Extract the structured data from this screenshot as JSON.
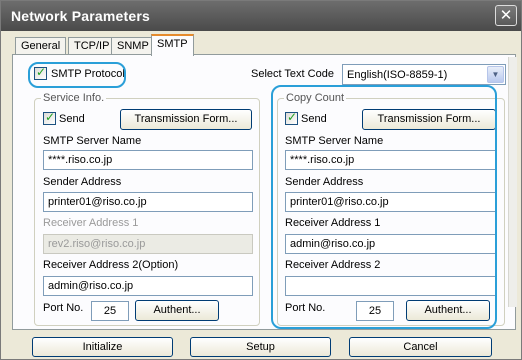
{
  "window": {
    "title": "Network Parameters",
    "close_glyph": "✕"
  },
  "tabs": [
    {
      "label": "General",
      "active": false
    },
    {
      "label": "TCP/IP",
      "active": false
    },
    {
      "label": "SNMP",
      "active": false
    },
    {
      "label": "SMTP",
      "active": true
    }
  ],
  "smtp_protocol": {
    "label": "SMTP Protocol",
    "checked": true
  },
  "text_code": {
    "label": "Select Text Code",
    "value": "English(ISO-8859-1)"
  },
  "service_info": {
    "title": "Service Info.",
    "send_label": "Send",
    "send_checked": true,
    "transmission_button": "Transmission Form...",
    "server_label": "SMTP Server Name",
    "server_value": "****.riso.co.jp",
    "sender_label": "Sender Address",
    "sender_value": "printer01@riso.co.jp",
    "receiver1_label": "Receiver Address 1",
    "receiver1_value": "rev2.riso@riso.co.jp",
    "receiver2_label": "Receiver Address 2(Option)",
    "receiver2_value": "admin@riso.co.jp",
    "port_label": "Port No.",
    "port_value": "25",
    "authent_button": "Authent..."
  },
  "copy_count": {
    "title": "Copy Count",
    "send_label": "Send",
    "send_checked": true,
    "transmission_button": "Transmission Form...",
    "server_label": "SMTP Server Name",
    "server_value": "****.riso.co.jp",
    "sender_label": "Sender Address",
    "sender_value": "printer01@riso.co.jp",
    "receiver1_label": "Receiver Address 1",
    "receiver1_value": "admin@riso.co.jp",
    "receiver2_label": "Receiver Address 2",
    "receiver2_value": "",
    "port_label": "Port No.",
    "port_value": "25",
    "authent_button": "Authent..."
  },
  "footer": {
    "initialize": "Initialize",
    "setup": "Setup",
    "cancel": "Cancel"
  },
  "colors": {
    "callout": "#2a9fd8",
    "tab_highlight": "#e68b2c",
    "title_bar": "#555555"
  }
}
